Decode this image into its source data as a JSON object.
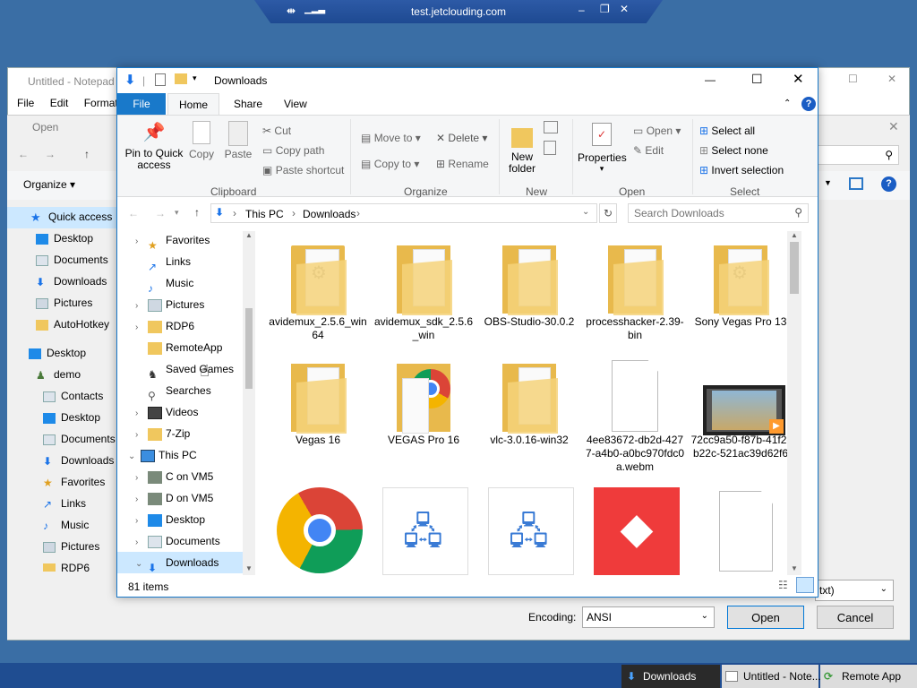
{
  "remote_bar": {
    "host": "test.jetclouding.com"
  },
  "notepad": {
    "title": "Untitled - Notepad",
    "menu": [
      "File",
      "Edit",
      "Format"
    ]
  },
  "open_dialog": {
    "title": "Open",
    "organize": "Organize",
    "nav": [
      "Quick access",
      "Desktop",
      "Documents",
      "Downloads",
      "Pictures",
      "AutoHotkey",
      "Desktop",
      "demo",
      "Contacts",
      "Desktop",
      "Documents",
      "Downloads",
      "Favorites",
      "Links",
      "Music",
      "Pictures",
      "RDP6"
    ],
    "encoding_label": "Encoding:",
    "encoding_value": "ANSI",
    "filetype_value": "txt)",
    "open_button": "Open",
    "cancel_button": "Cancel"
  },
  "explorer": {
    "title": "Downloads",
    "tabs": [
      "File",
      "Home",
      "Share",
      "View"
    ],
    "clipboard": {
      "pin": "Pin to Quick access",
      "copy": "Copy",
      "paste": "Paste",
      "cut": "Cut",
      "copy_path": "Copy path",
      "paste_shortcut": "Paste shortcut",
      "group": "Clipboard"
    },
    "organize": {
      "move_to": "Move to",
      "copy_to": "Copy to",
      "delete": "Delete",
      "rename": "Rename",
      "group": "Organize"
    },
    "new": {
      "new_folder": "New folder",
      "group": "New"
    },
    "open": {
      "properties": "Properties",
      "open": "Open",
      "edit": "Edit",
      "group": "Open"
    },
    "select": {
      "select_all": "Select all",
      "select_none": "Select none",
      "invert": "Invert selection",
      "group": "Select"
    },
    "breadcrumb": [
      "This PC",
      "Downloads"
    ],
    "search_placeholder": "Search Downloads",
    "tree": [
      "Favorites",
      "Links",
      "Music",
      "Pictures",
      "RDP6",
      "RemoteApp",
      "Saved Games",
      "Searches",
      "Videos",
      "7-Zip",
      "This PC",
      "C on VM5",
      "D on VM5",
      "Desktop",
      "Documents",
      "Downloads"
    ],
    "files": [
      {
        "name": "avidemux_2.5.6_win64",
        "kind": "folder"
      },
      {
        "name": "avidemux_sdk_2.5.6_win",
        "kind": "folder"
      },
      {
        "name": "OBS-Studio-30.0.2",
        "kind": "folder"
      },
      {
        "name": "processhacker-2.39-bin",
        "kind": "folder"
      },
      {
        "name": "Sony Vegas Pro 13",
        "kind": "folder"
      },
      {
        "name": "Vegas 16",
        "kind": "folder"
      },
      {
        "name": "VEGAS Pro 16",
        "kind": "folder"
      },
      {
        "name": "vlc-3.0.16-win32",
        "kind": "folder"
      },
      {
        "name": "4ee83672-db2d-4277-a4b0-a0bc970fdc0a.webm",
        "kind": "file"
      },
      {
        "name": "72cc9a50-f87b-41f2-b22c-521ac39d62f6",
        "kind": "video"
      }
    ],
    "status": "81 items"
  },
  "taskbar": [
    "Downloads",
    "Untitled - Note...",
    "Remote App"
  ],
  "colors": {
    "accent": "#1979ca",
    "desktop": "#3a6ea5",
    "folder": "#f0c75e"
  }
}
